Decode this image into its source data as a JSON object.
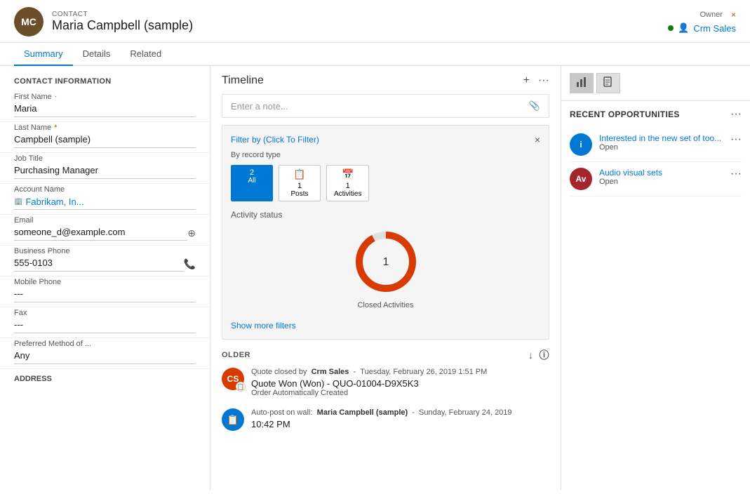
{
  "header": {
    "entity_type": "CONTACT",
    "title": "Maria Campbell (sample)",
    "avatar_initials": "MC",
    "owner_label": "Owner",
    "owner_name": "Crm Sales"
  },
  "tabs": {
    "items": [
      "Summary",
      "Details",
      "Related"
    ],
    "active": "Summary"
  },
  "contact_info": {
    "section_title": "CONTACT INFORMATION",
    "fields": [
      {
        "label": "First Name",
        "value": "Maria",
        "required": false,
        "has_required_dot": true
      },
      {
        "label": "Last Name",
        "value": "Campbell (sample)",
        "required": true
      },
      {
        "label": "Job Title",
        "value": "Purchasing Manager"
      },
      {
        "label": "Account Name",
        "value": "Fabrikam, In...",
        "is_link": true
      },
      {
        "label": "Email",
        "value": "someone_d@example.com",
        "has_icon": true
      },
      {
        "label": "Business Phone",
        "value": "555-0103",
        "has_icon": true
      },
      {
        "label": "Mobile Phone",
        "value": "---"
      },
      {
        "label": "Fax",
        "value": "---"
      },
      {
        "label": "Preferred Method of ...",
        "value": "Any"
      }
    ],
    "address_title": "ADDRESS"
  },
  "timeline": {
    "title": "Timeline",
    "note_placeholder": "Enter a note...",
    "filter": {
      "label": "Filter by",
      "clickable": "(Click To Filter)",
      "record_type_label": "By record type",
      "buttons": [
        {
          "label": "All",
          "count": "2",
          "is_count": true
        },
        {
          "label": "Posts",
          "count": "1",
          "icon": "📋"
        },
        {
          "label": "Activities",
          "count": "1",
          "icon": "📅"
        }
      ],
      "activity_status_label": "Activity status",
      "closed_activities_count": "1",
      "closed_activities_label": "Closed Activities",
      "show_more": "Show more filters"
    },
    "older_section": "OLDER",
    "entries": [
      {
        "avatar_initials": "CS",
        "avatar_color": "#d83b01",
        "has_badge": true,
        "badge_icon": "📋",
        "meta": "Quote closed by  Crm Sales  -  Tuesday, February 26, 2019 1:51 PM",
        "body": "Quote Won (Won) - QUO-01004-D9X5K3",
        "sub": "Order Automatically Created"
      },
      {
        "avatar_initials": "📋",
        "avatar_color": "#0078d4",
        "is_icon": true,
        "meta": "Auto-post on wall:  Maria Campbell (sample)  -  Sunday, February 24, 2019",
        "body": "10:42 PM",
        "sub": ""
      }
    ]
  },
  "right_panel": {
    "tabs": [
      "chart-icon",
      "document-icon"
    ],
    "section_title": "RECENT OPPORTUNITIES",
    "opportunities": [
      {
        "avatar_initials": "i",
        "avatar_color": "#0078d4",
        "title": "Interested in the new set of too...",
        "status": "Open"
      },
      {
        "avatar_initials": "Av",
        "avatar_color": "#a4262c",
        "title": "Audio visual sets",
        "status": "Open"
      }
    ]
  }
}
